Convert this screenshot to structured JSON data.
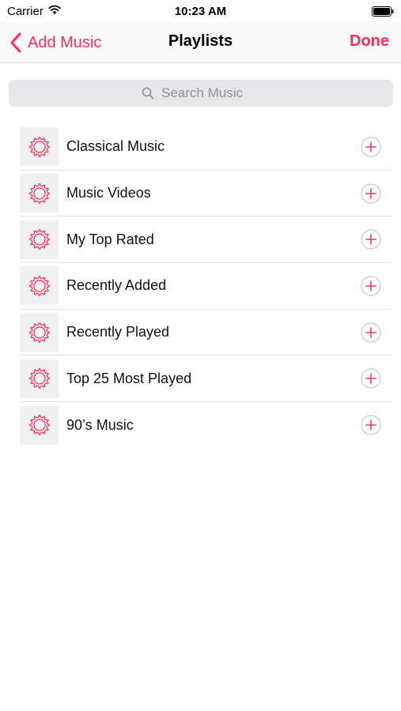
{
  "status_bar": {
    "carrier": "Carrier",
    "time": "10:23 AM"
  },
  "nav": {
    "back_label": "Add Music",
    "title": "Playlists",
    "done_label": "Done"
  },
  "search": {
    "placeholder": "Search Music"
  },
  "playlists": [
    {
      "label": "Classical Music"
    },
    {
      "label": "Music Videos"
    },
    {
      "label": "My Top Rated"
    },
    {
      "label": "Recently Added"
    },
    {
      "label": "Recently Played"
    },
    {
      "label": "Top 25 Most Played"
    },
    {
      "label": "90’s Music"
    }
  ],
  "icons": {
    "playlist": "gear-playlist-icon",
    "add": "plus-circle-icon",
    "back": "chevron-left-icon",
    "search": "search-icon"
  },
  "colors": {
    "accent": "#ff2d55",
    "thumb_bg": "#f1f1f4",
    "search_bg": "#e6e6eb"
  }
}
